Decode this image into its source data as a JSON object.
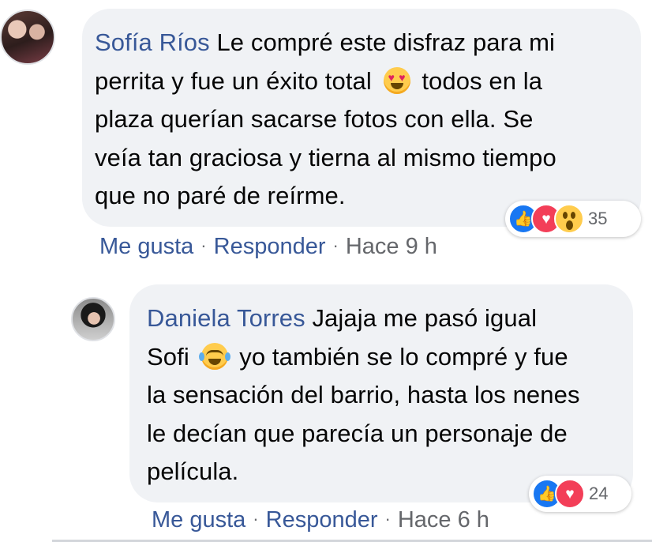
{
  "comments": [
    {
      "author": "Sofía Ríos",
      "lines": [
        "Le compré este disfraz para mi",
        "perrita y fue un éxito total",
        "todos en la",
        "plaza querían sacarse fotos con ella. Se",
        "veía tan graciosa y tierna al mismo tiempo",
        "que no paré de reírme."
      ],
      "emoji": "heart-eyes-emoji",
      "reactions": {
        "icons": [
          "like-icon",
          "love-icon",
          "wow-icon"
        ],
        "count": "35"
      },
      "actions": {
        "like": "Me gusta",
        "reply": "Responder",
        "time": "Hace 9 h",
        "separator": "·"
      }
    },
    {
      "author": "Daniela Torres",
      "lines": [
        "Jajaja me pasó igual",
        "Sofi",
        "yo también se lo compré y fue",
        "la sensación del barrio, hasta los nenes",
        "le decían que parecía un personaje de",
        "película."
      ],
      "emoji": "tears-of-joy-emoji",
      "reactions": {
        "icons": [
          "like-icon",
          "love-icon"
        ],
        "count": "24"
      },
      "actions": {
        "like": "Me gusta",
        "reply": "Responder",
        "time": "Hace 6 h",
        "separator": "·"
      }
    }
  ],
  "colors": {
    "link": "#385898",
    "bubble": "#f0f2f5",
    "meta": "#65676b",
    "like": "#1877f2",
    "love": "#f33e58"
  }
}
